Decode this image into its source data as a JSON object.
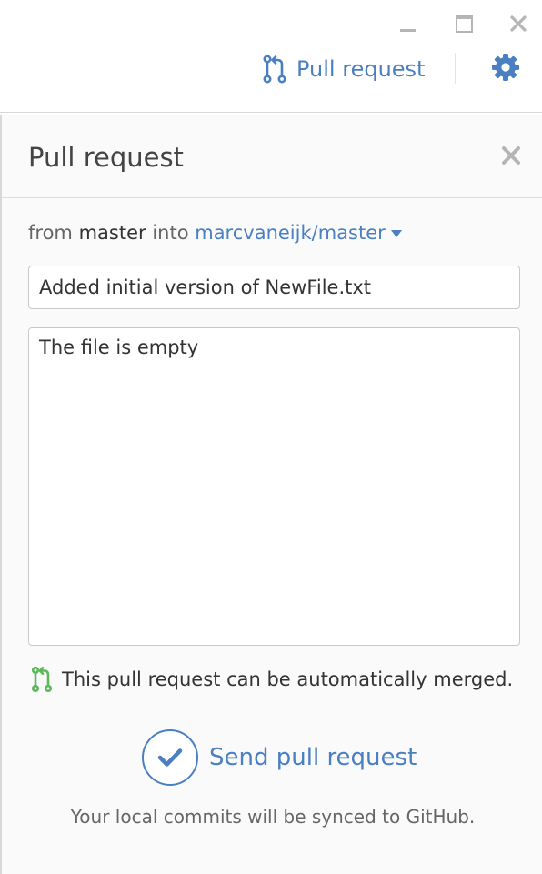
{
  "toolbar": {
    "pull_request_label": "Pull request"
  },
  "panel": {
    "title": "Pull request",
    "from_label": "from",
    "source_branch": "master",
    "into_label": "into",
    "target_branch": "marcvaneijk/master",
    "title_value": "Added initial version of NewFile.txt",
    "description_value": "The file is empty",
    "merge_status": "This pull request can be automatically merged.",
    "send_label": "Send pull request",
    "sync_note": "Your local commits will be synced to GitHub."
  },
  "icons": {
    "pull_request": "git-pull-request-icon",
    "settings": "gear-icon",
    "close": "close-icon",
    "minimize": "minimize-icon",
    "maximize": "maximize-icon",
    "merge_ok": "git-pull-request-icon",
    "send": "checkmark-icon"
  },
  "colors": {
    "accent": "#4a7fc1",
    "success": "#5cb85c",
    "chrome_icon": "#b5b5b5"
  }
}
